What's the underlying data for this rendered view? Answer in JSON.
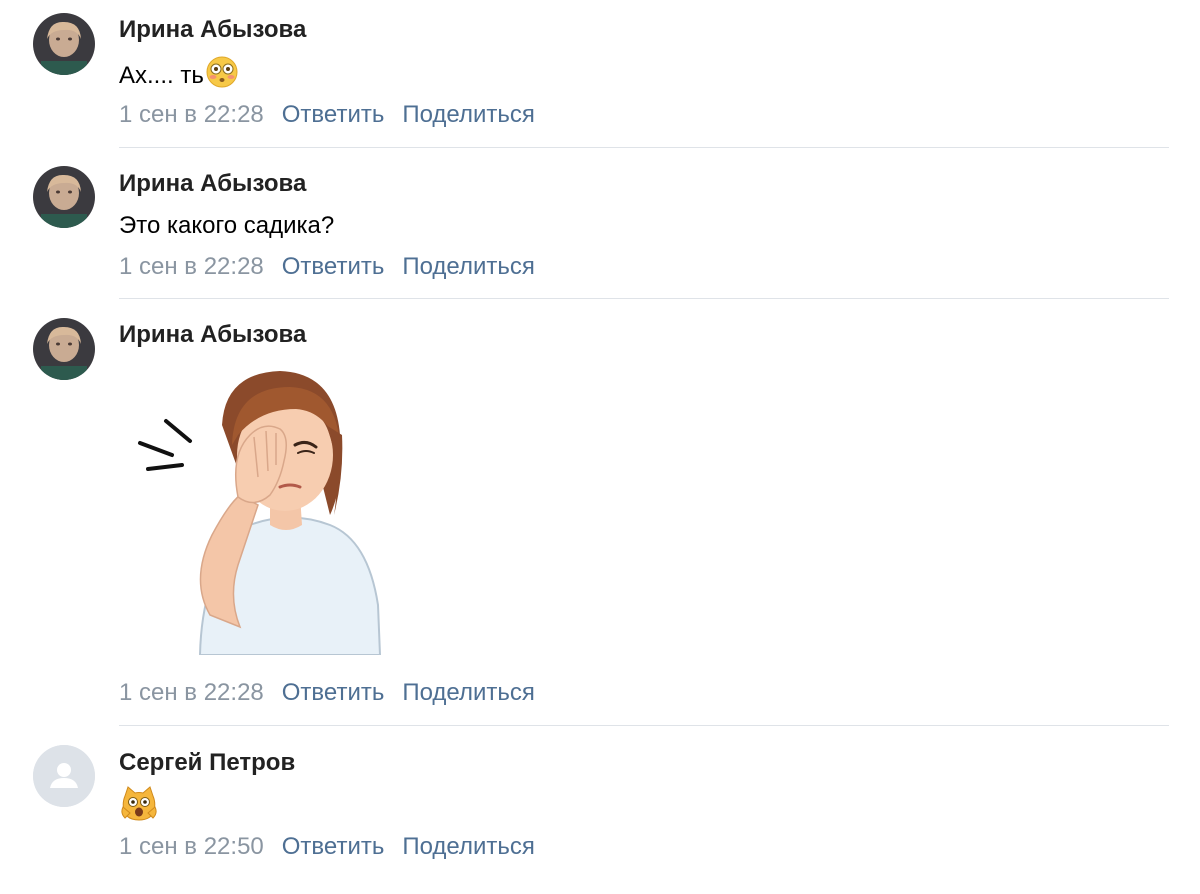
{
  "comments": [
    {
      "author": "Ирина Абызова",
      "text": "Ах.... ть",
      "emoji": "flushed-face-emoji",
      "time": "1 сен в 22:28",
      "reply_label": "Ответить",
      "share_label": "Поделиться"
    },
    {
      "author": "Ирина Абызова",
      "text": "Это какого садика?",
      "time": "1 сен в 22:28",
      "reply_label": "Ответить",
      "share_label": "Поделиться"
    },
    {
      "author": "Ирина Абызова",
      "sticker": "facepalm-woman-sticker",
      "time": "1 сен в 22:28",
      "reply_label": "Ответить",
      "share_label": "Поделиться"
    },
    {
      "author": "Сергей Петров",
      "emoji": "screaming-cat-emoji",
      "time": "1 сен в 22:50",
      "reply_label": "Ответить",
      "share_label": "Поделиться"
    }
  ],
  "colors": {
    "link": "#4e6f93",
    "timestamp": "#8a95a1",
    "separator": "#dfe3e8",
    "author": "#222222"
  }
}
